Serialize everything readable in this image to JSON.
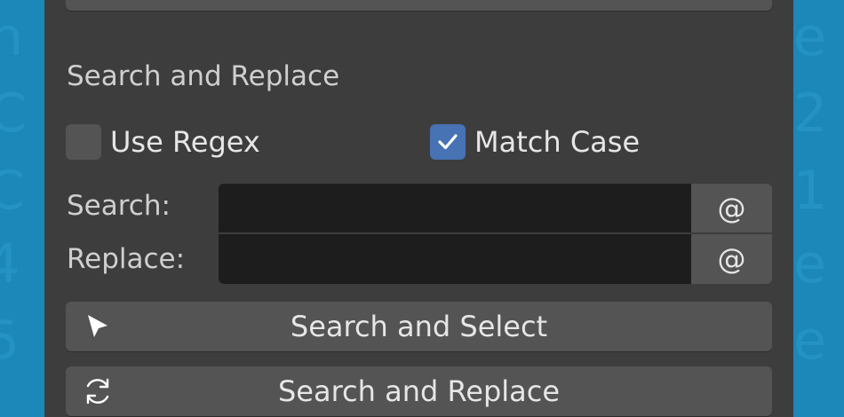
{
  "section": {
    "title": "Search and Replace"
  },
  "options": {
    "use_regex": {
      "label": "Use Regex",
      "checked": false
    },
    "match_case": {
      "label": "Match Case",
      "checked": true
    }
  },
  "fields": {
    "search": {
      "label": "Search:",
      "value": "",
      "button_label": "@"
    },
    "replace": {
      "label": "Replace:",
      "value": "",
      "button_label": "@"
    }
  },
  "buttons": {
    "search_select": {
      "label": "Search and Select",
      "icon": "cursor-arrow-icon"
    },
    "search_replace": {
      "label": "Search and Replace",
      "icon": "refresh-icon"
    }
  },
  "colors": {
    "panel": "#3d3d3d",
    "button": "#545454",
    "field": "#1d1d1d",
    "accent": "#4772b3",
    "backdrop": "#1b88b9"
  }
}
